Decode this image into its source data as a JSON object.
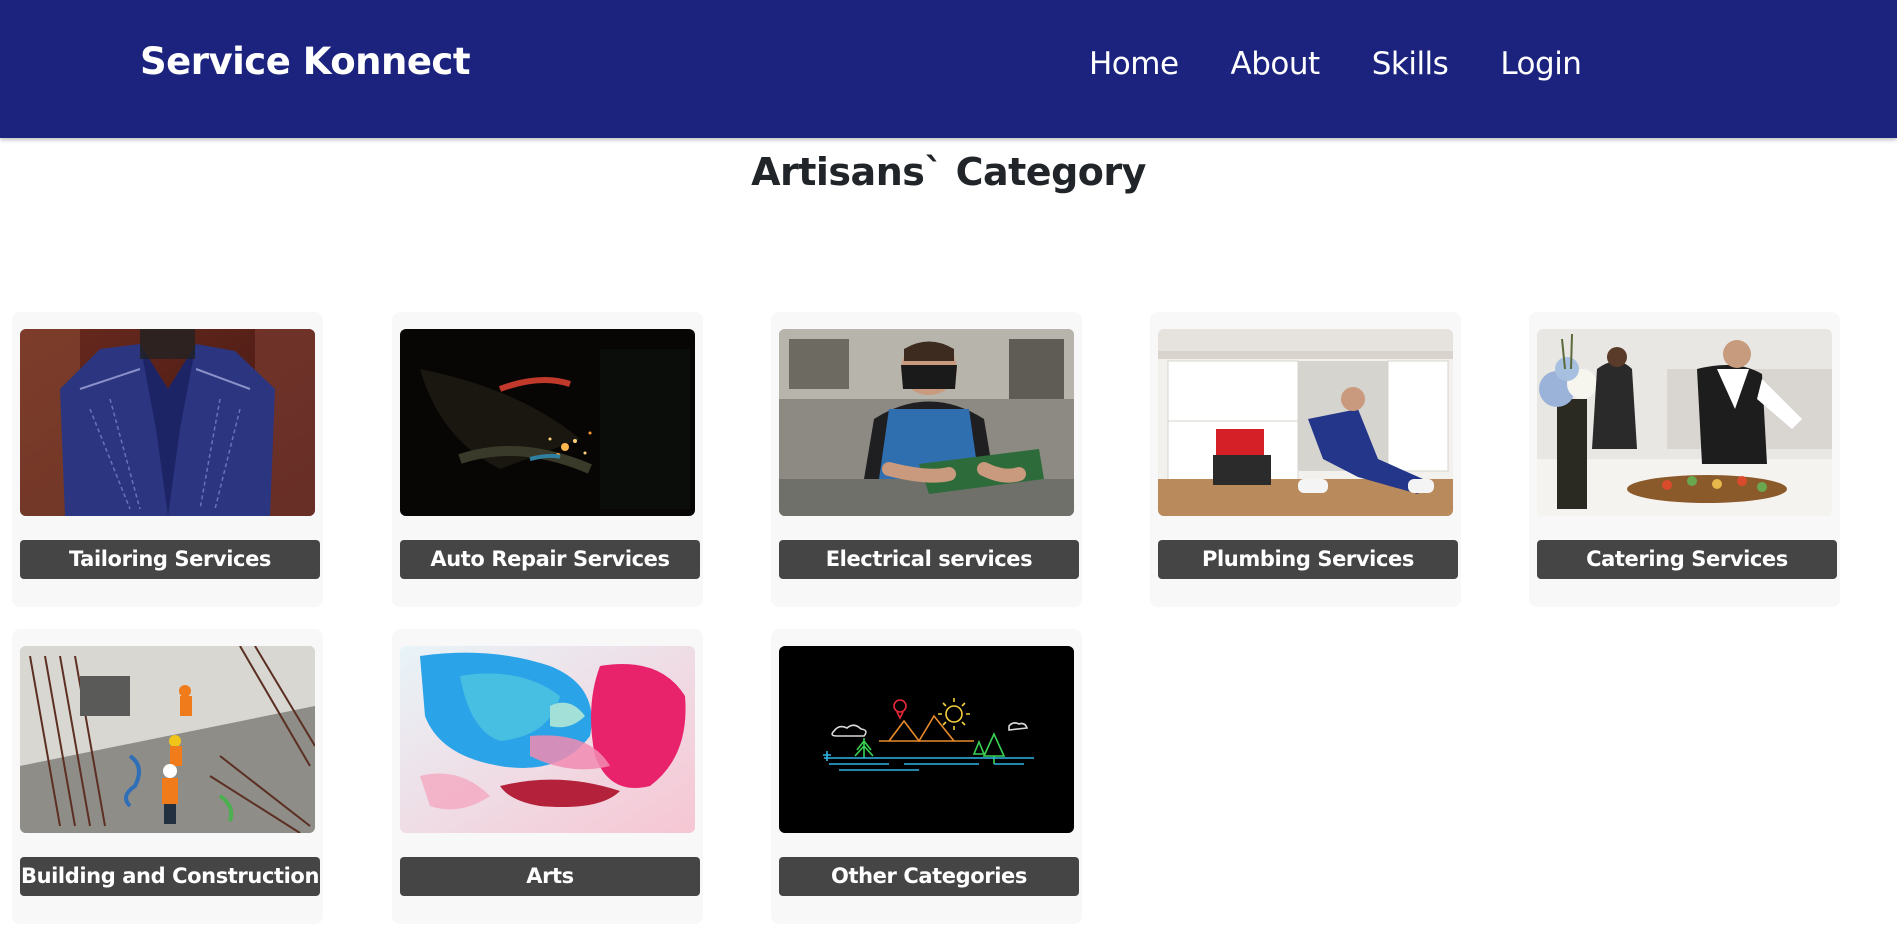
{
  "navbar": {
    "brand": "Service Konnect",
    "links": [
      "Home",
      "About",
      "Skills",
      "Login"
    ],
    "background": "#1b237f"
  },
  "main": {
    "title": "Artisans` Category",
    "categories": [
      {
        "label": "Tailoring Services",
        "image": "tailoring-image"
      },
      {
        "label": "Auto Repair Services",
        "image": "auto-repair-image"
      },
      {
        "label": "Electrical services",
        "image": "electrical-image"
      },
      {
        "label": "Plumbing Services",
        "image": "plumbing-image"
      },
      {
        "label": "Catering Services",
        "image": "catering-image"
      },
      {
        "label": "Building and Construction",
        "image": "construction-image"
      },
      {
        "label": "Arts",
        "image": "arts-image"
      },
      {
        "label": "Other Categories",
        "image": "other-categories-image"
      }
    ],
    "button_color": "#454545"
  }
}
